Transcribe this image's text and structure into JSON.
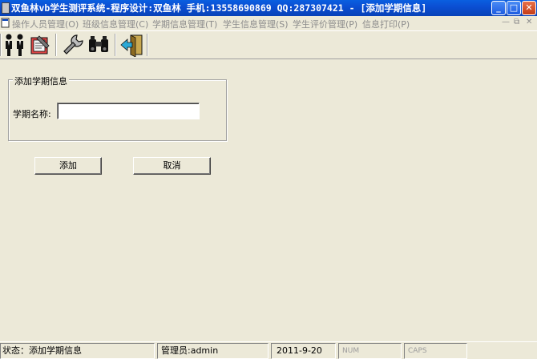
{
  "window": {
    "title": "双鱼林vb学生测评系统-程序设计:双鱼林 手机:13558690869 QQ:287307421 - [添加学期信息]",
    "controls": {
      "minimize": "_",
      "maximize": "□",
      "close": "✕"
    }
  },
  "menu": {
    "items": [
      "操作人员管理(O)",
      "班级信息管理(C)",
      "学期信息管理(T)",
      "学生信息管理(S)",
      "学生评价管理(P)",
      "信息打印(P)"
    ],
    "mdi_controls": {
      "minimize": "—",
      "restore": "⧉",
      "close": "✕"
    }
  },
  "toolbar": {
    "icons": [
      "users-icon",
      "notebook-icon",
      "wrench-icon",
      "binoculars-icon",
      "exit-door-icon"
    ]
  },
  "form": {
    "group_title": "添加学期信息",
    "term_name_label": "学期名称:",
    "term_name_value": "",
    "add_button": "添加",
    "cancel_button": "取消"
  },
  "status": {
    "state": "状态：添加学期信息",
    "admin": "管理员:admin",
    "date": "2011-9-20",
    "num": "NUM",
    "caps": "CAPS"
  }
}
